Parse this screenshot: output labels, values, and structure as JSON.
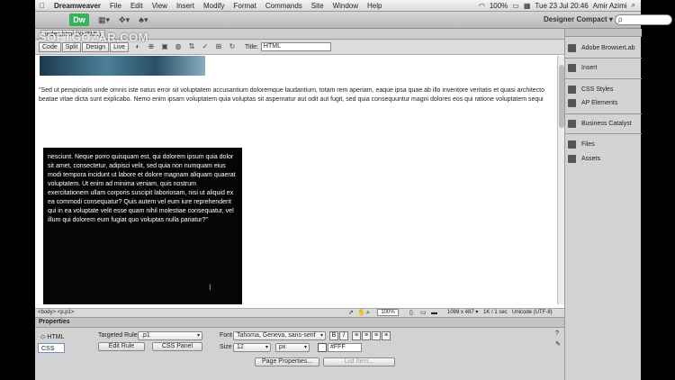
{
  "menubar": {
    "app": "Dreamweaver",
    "items": [
      "File",
      "Edit",
      "View",
      "Insert",
      "Modify",
      "Format",
      "Commands",
      "Site",
      "Window",
      "Help"
    ],
    "battery": "100%",
    "clock": "Tue 23 Jul  20:46",
    "user": "Amir Azimi"
  },
  "appbar": {
    "logo": "Dw",
    "workspace": "Designer Compact ▾",
    "search_placeholder": "ρ"
  },
  "document": {
    "tab": "index.html (XHTML)",
    "view_buttons": [
      "Code",
      "Split",
      "Design",
      "Live"
    ],
    "title_label": "Title:",
    "title_value": "HTML"
  },
  "content": {
    "paragraph1": "\"Sed ut perspiciatis unde omnis iste natus error sit voluptatem accusantium doloremque laudantium, totam rem aperiam, eaque ipsa quae ab illo inventore veritatis et quasi architecto beatae vitae dicta sunt explicabo. Nemo enim ipsam voluptatem quia voluptas sit aspernatur aut odit aut fugit, sed quia consequuntur magni dolores eos qui ratione voluptatem sequi",
    "paragraph2": "nesciunt. Neque porro quisquam est, qui dolorem ipsum quia dolor sit amet, consectetur, adipisci velit, sed quia non numquam eius modi tempora incidunt ut labore et dolore magnam aliquam quaerat voluptatem. Ut enim ad minima veniam, quis nostrum exercitationem ullam corporis suscipit laboriosam, nisi ut aliquid ex ea commodi consequatur? Quis autem vel eum iure reprehenderit qui in ea voluptate velit esse quam nihil molestiae consequatur, vel illum qui dolorem eum fugiat quo voluptas nulla pariatur?\""
  },
  "statusbar": {
    "tag_selector": "<body> <p.p1>",
    "zoom": "100%",
    "dimensions": "1099 x 487 ▾",
    "download": "1K / 1 sec",
    "encoding": "Unicode (UTF-8)"
  },
  "properties": {
    "title": "Properties",
    "mode_html": "HTML",
    "mode_css": "CSS",
    "targeted_rule_label": "Targeted Rule",
    "targeted_rule_value": ".p1",
    "edit_rule": "Edit Rule",
    "css_panel": "CSS Panel",
    "font_label": "Font",
    "font_value": "Tahoma, Geneva, sans-serif",
    "size_label": "Size",
    "size_value": "12",
    "size_unit": "px",
    "color_value": "#FFF",
    "page_properties": "Page Properties...",
    "list_item": "List Item..."
  },
  "panels": [
    "Adobe BrowserLab",
    "Insert",
    "CSS Styles",
    "AP Elements",
    "Business Catalyst",
    "Files",
    "Assets"
  ],
  "watermark": "SOFTGOZAR.COM"
}
